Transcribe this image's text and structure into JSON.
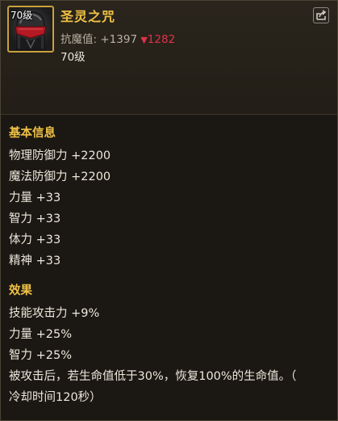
{
  "item": {
    "level_badge": "70级",
    "name": "圣灵之咒",
    "resist_label": "抗魔值:",
    "resist_plus": "+1397",
    "resist_down_arrow": "▼",
    "resist_down": "1282",
    "level_requirement": "70级",
    "icon": "helmet-icon",
    "corner_icon": "share-icon"
  },
  "basic_info": {
    "title": "基本信息",
    "stats": [
      "物理防御力 +2200",
      "魔法防御力 +2200",
      "力量 +33",
      "智力 +33",
      "体力 +33",
      "精神 +33"
    ]
  },
  "effects": {
    "title": "效果",
    "lines": [
      "技能攻击力 +9%",
      "力量 +25%",
      "智力 +25%",
      "被攻击后，若生命值低于30%，恢复100%的生命值。（",
      "冷却时间120秒）"
    ]
  },
  "colors": {
    "name": "#f0c245",
    "section_title": "#f0c245",
    "resist_down": "#e0324a",
    "icon_border": "#caa03e",
    "background": "#1b1813"
  }
}
